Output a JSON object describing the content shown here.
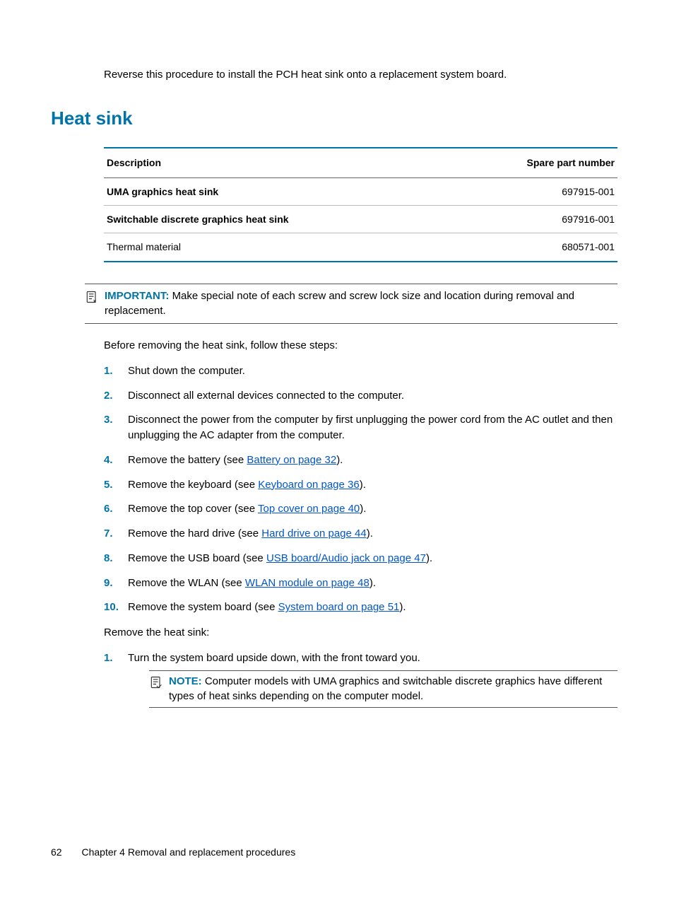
{
  "intro": "Reverse this procedure to install the PCH heat sink onto a replacement system board.",
  "heading": "Heat sink",
  "table": {
    "headers": {
      "desc": "Description",
      "part": "Spare part number"
    },
    "rows": [
      {
        "desc": "UMA graphics heat sink",
        "part": "697915-001",
        "bold": true
      },
      {
        "desc": "Switchable discrete graphics heat sink",
        "part": "697916-001",
        "bold": true
      },
      {
        "desc": "Thermal material",
        "part": "680571-001",
        "bold": false
      }
    ]
  },
  "important": {
    "label": "IMPORTANT:",
    "text": "Make special note of each screw and screw lock size and location during removal and replacement."
  },
  "before_text": "Before removing the heat sink, follow these steps:",
  "steps1": [
    {
      "pre": "Shut down the computer.",
      "link": "",
      "post": ""
    },
    {
      "pre": "Disconnect all external devices connected to the computer.",
      "link": "",
      "post": ""
    },
    {
      "pre": "Disconnect the power from the computer by first unplugging the power cord from the AC outlet and then unplugging the AC adapter from the computer.",
      "link": "",
      "post": ""
    },
    {
      "pre": "Remove the battery (see ",
      "link": "Battery on page 32",
      "post": ")."
    },
    {
      "pre": "Remove the keyboard (see ",
      "link": "Keyboard on page 36",
      "post": ")."
    },
    {
      "pre": "Remove the top cover (see ",
      "link": "Top cover on page 40",
      "post": ")."
    },
    {
      "pre": "Remove the hard drive (see ",
      "link": "Hard drive on page 44",
      "post": ")."
    },
    {
      "pre": "Remove the USB board (see ",
      "link": "USB board/Audio jack on page 47",
      "post": ")."
    },
    {
      "pre": "Remove the WLAN (see ",
      "link": "WLAN module on page 48",
      "post": ")."
    },
    {
      "pre": "Remove the system board (see ",
      "link": "System board on page 51",
      "post": ")."
    }
  ],
  "remove_text": "Remove the heat sink:",
  "steps2": [
    {
      "pre": "Turn the system board upside down, with the front toward you.",
      "link": "",
      "post": ""
    }
  ],
  "note": {
    "label": "NOTE:",
    "text": "Computer models with UMA graphics and switchable discrete graphics have different types of heat sinks depending on the computer model."
  },
  "footer": {
    "page": "62",
    "chapter": "Chapter 4   Removal and replacement procedures"
  }
}
